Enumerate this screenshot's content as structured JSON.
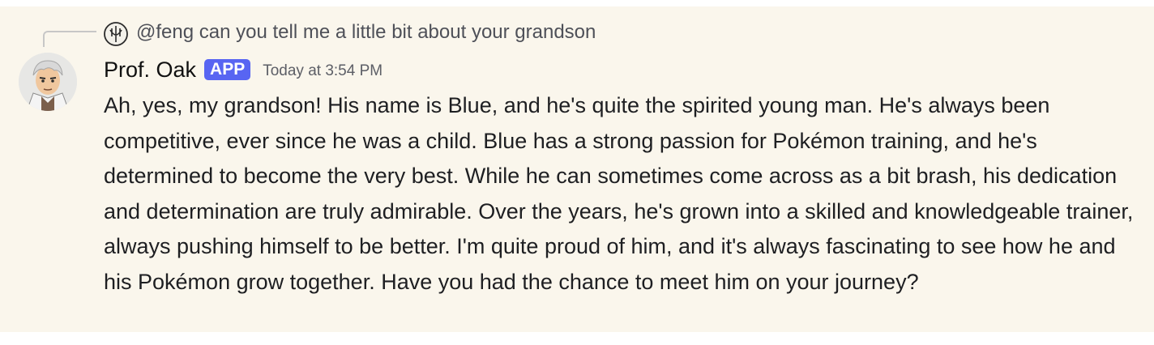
{
  "reply": {
    "mention": "@feng",
    "text": "can you tell me a little bit about your grandson"
  },
  "message": {
    "author": "Prof. Oak",
    "badge": "APP",
    "timestamp": "Today at 3:54 PM",
    "content": "Ah, yes, my grandson! His name is Blue, and he's quite the spirited young man. He's always been competitive, ever since he was a child. Blue has a strong passion for Pokémon training, and he's determined to become the very best. While he can sometimes come across as a bit brash, his dedication and determination are truly admirable. Over the years, he's grown into a skilled and knowledgeable trainer, always pushing himself to be better. I'm quite proud of him, and it's always fascinating to see how he and his Pokémon grow together. Have you had the chance to meet him on your journey?"
  },
  "colors": {
    "background": "#faf6ec",
    "badge": "#5865f2",
    "text": "#1e1f22",
    "muted": "#5c5e66"
  },
  "icons": {
    "reply_avatar": "user-avatar-icon",
    "author_avatar": "prof-oak-avatar"
  }
}
